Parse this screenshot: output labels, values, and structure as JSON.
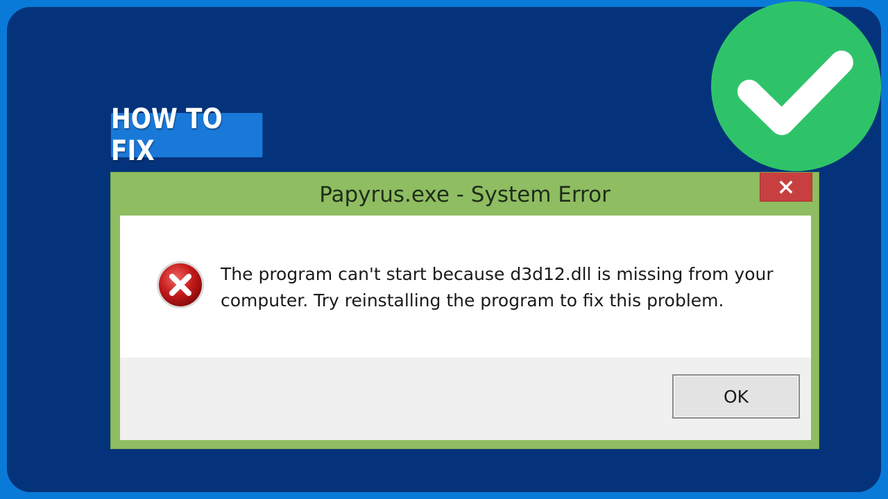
{
  "thumbnail": {
    "badge_text": "HOW TO FIX",
    "checkmark_icon": "check-circle-icon",
    "colors": {
      "outer_border": "#0a7ad8",
      "background": "#04337b",
      "badge": "#1979d9",
      "check_circle": "#2fc369"
    }
  },
  "dialog": {
    "title": "Papyrus.exe - System Error",
    "close_icon": "close-icon",
    "error_icon": "error-icon",
    "message": "The program can't start because d3d12.dll is missing from your computer. Try reinstalling the program to fix this problem.",
    "ok_label": "OK",
    "colors": {
      "title_bar": "#8fbd61",
      "close_button": "#c7403f",
      "footer": "#f0f0f0"
    }
  }
}
